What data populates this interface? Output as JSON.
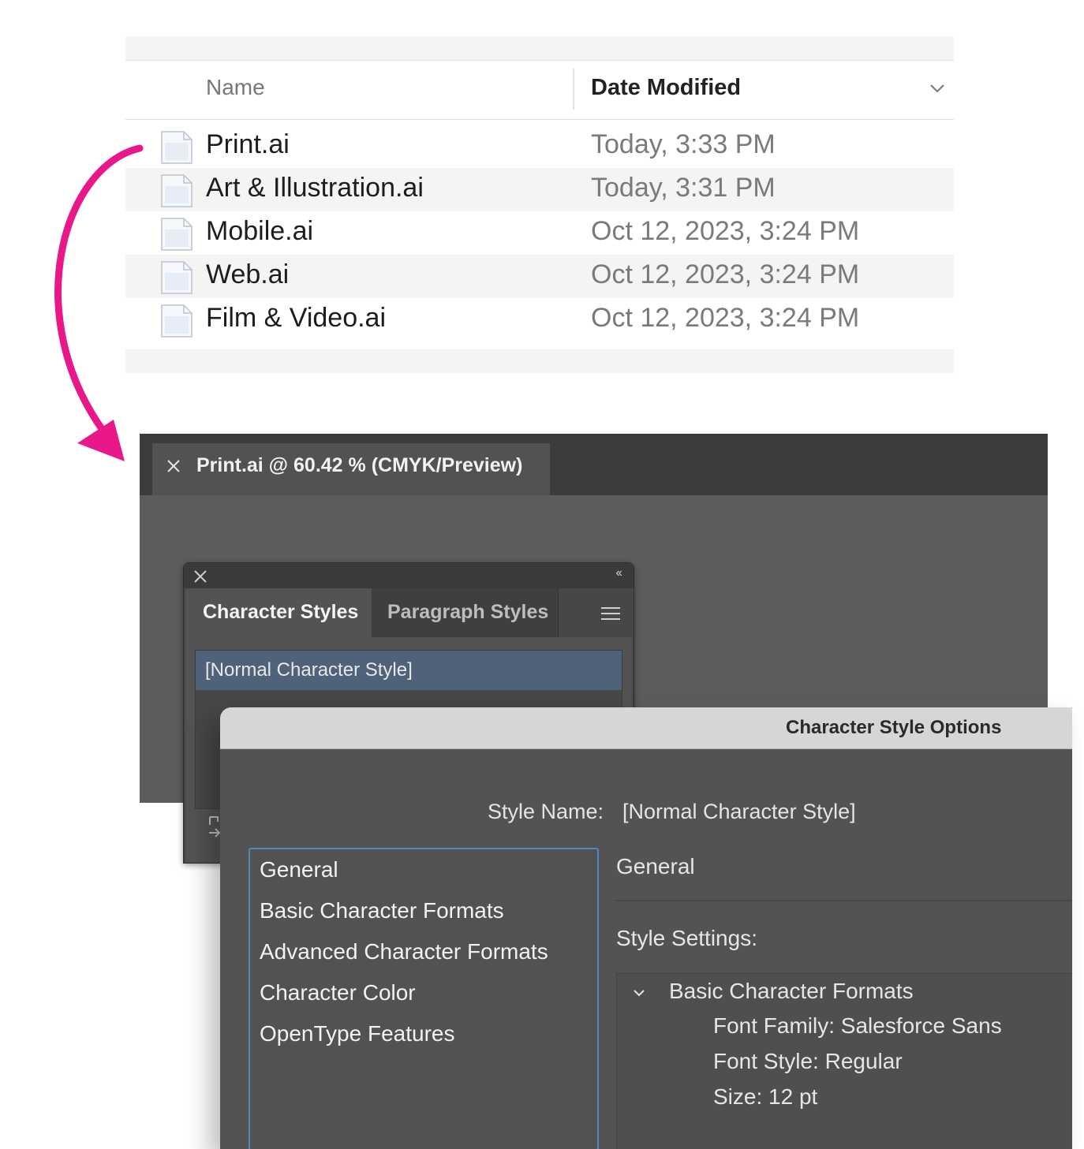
{
  "finder": {
    "columns": {
      "name": "Name",
      "date_modified": "Date Modified"
    },
    "files": [
      {
        "name": "Print.ai",
        "date": "Today, 3:33 PM"
      },
      {
        "name": "Art & Illustration.ai",
        "date": "Today, 3:31 PM"
      },
      {
        "name": "Mobile.ai",
        "date": "Oct 12, 2023, 3:24 PM"
      },
      {
        "name": "Web.ai",
        "date": "Oct 12, 2023, 3:24 PM"
      },
      {
        "name": "Film & Video.ai",
        "date": "Oct 12, 2023, 3:24 PM"
      }
    ]
  },
  "arrow": {
    "color": "#e8178a"
  },
  "illustrator": {
    "document_tab": "Print.ai @ 60.42 % (CMYK/Preview)"
  },
  "styles_panel": {
    "tabs": [
      "Character Styles",
      "Paragraph Styles"
    ],
    "selected_style": "[Normal Character Style]",
    "selection_color": "#506279"
  },
  "dialog": {
    "title": "Character Style Options",
    "style_name_label": "Style Name:",
    "style_name_value": "[Normal Character Style]",
    "categories": [
      "General",
      "Basic Character Formats",
      "Advanced Character Formats",
      "Character Color",
      "OpenType Features"
    ],
    "section_title": "General",
    "style_settings_label": "Style Settings:",
    "settings_group": "Basic Character Formats",
    "settings": [
      "Font Family: Salesforce Sans",
      "Font Style: Regular",
      "Size: 12 pt"
    ],
    "focus_color": "#4a88c7"
  }
}
